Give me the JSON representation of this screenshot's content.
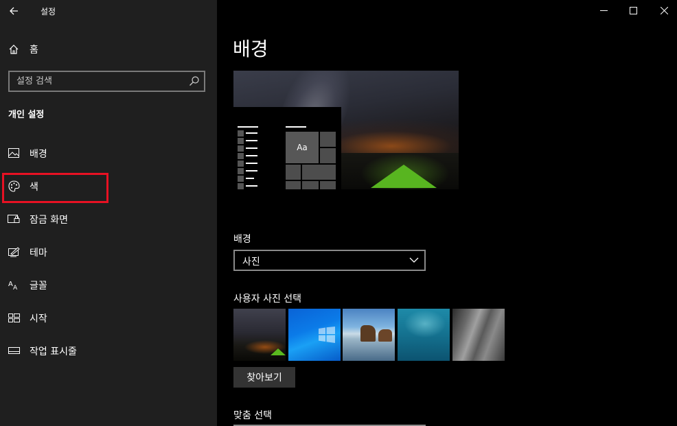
{
  "window": {
    "title": "설정",
    "controls": {
      "minimize": "minimize-icon",
      "maximize": "maximize-icon",
      "close": "close-icon"
    }
  },
  "sidebar": {
    "home_label": "홈",
    "search_placeholder": "설정 검색",
    "section_title": "개인 설정",
    "items": [
      {
        "label": "배경",
        "icon": "picture-icon"
      },
      {
        "label": "색",
        "icon": "palette-icon",
        "highlighted": true
      },
      {
        "label": "잠금 화면",
        "icon": "lock-screen-icon"
      },
      {
        "label": "테마",
        "icon": "theme-icon"
      },
      {
        "label": "글꼴",
        "icon": "font-icon"
      },
      {
        "label": "시작",
        "icon": "start-icon"
      },
      {
        "label": "작업 표시줄",
        "icon": "taskbar-icon"
      }
    ],
    "highlight_color": "#e81123"
  },
  "main": {
    "title": "배경",
    "preview_sample_text": "Aa",
    "background_label": "배경",
    "background_value": "사진",
    "choose_picture_label": "사용자 사진 선택",
    "thumbnails": [
      "night-sky-tent",
      "windows-blue",
      "beach-rocks",
      "underwater-swimmer",
      "rock-cliff"
    ],
    "browse_button": "찾아보기",
    "fit_label": "맞춤 선택"
  },
  "colors": {
    "sidebar_bg": "#1f1f1f",
    "main_bg": "#000000",
    "button_bg": "#333333"
  }
}
